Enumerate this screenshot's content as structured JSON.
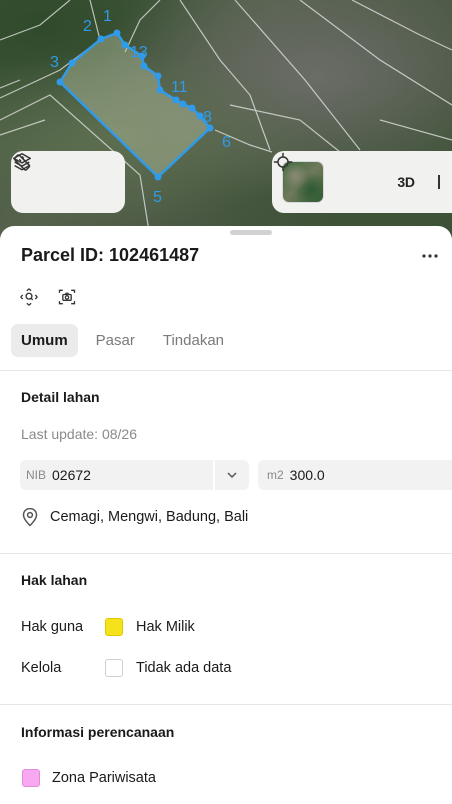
{
  "map": {
    "vertex_labels": [
      "1",
      "2",
      "3",
      "13",
      "11",
      "8",
      "6",
      "5"
    ],
    "parcel_color": "#2f9bea",
    "layers_icon": "layers-icon",
    "measure_icon": "ruler-icon",
    "locate_icon": "crosshair-icon",
    "view_3d_label": "3D"
  },
  "sheet": {
    "title": "Parcel ID: 102461487",
    "more_icon": "more-dots-icon",
    "tools": [
      "search-location-icon",
      "camera-icon"
    ],
    "tabs": [
      {
        "label": "Umum",
        "active": true
      },
      {
        "label": "Pasar",
        "active": false
      },
      {
        "label": "Tindakan",
        "active": false
      }
    ]
  },
  "detail": {
    "heading": "Detail lahan",
    "last_update": "Last update: 08/26",
    "nib_prefix": "NIB",
    "nib_value": "02672",
    "area_prefix": "m2",
    "area_value": "300.0",
    "location": "Cemagi, Mengwi, Badung, Bali"
  },
  "rights": {
    "heading": "Hak lahan",
    "rows": [
      {
        "key": "Hak guna",
        "value": "Hak Milik",
        "color": "#f5e21b"
      },
      {
        "key": "Kelola",
        "value": "Tidak ada data",
        "color": "#ffffff"
      }
    ]
  },
  "planning": {
    "heading": "Informasi perencanaan",
    "zone": "Zona Pariwisata",
    "zone_color": "#f7a8f0"
  }
}
